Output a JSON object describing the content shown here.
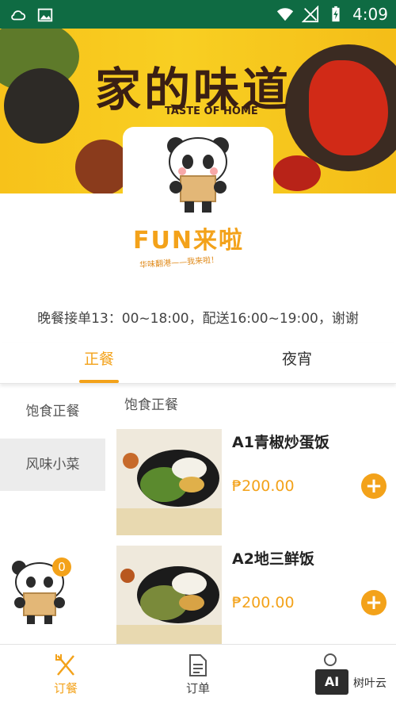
{
  "status_bar": {
    "time": "4:09",
    "icons": [
      "cloud-sync-icon",
      "image-icon",
      "wifi-icon",
      "no-signal-icon",
      "battery-charging-icon"
    ]
  },
  "banner": {
    "title": "家的味道",
    "subtitle": "TASTE OF HOME"
  },
  "brand": {
    "name": "FUN来啦",
    "slogan": "华味翻港——我来啦！"
  },
  "notice": "晚餐接单13：00~18:00，配送16:00~19:00，谢谢",
  "tabs": [
    {
      "label": "正餐",
      "active": true
    },
    {
      "label": "夜宵",
      "active": false
    }
  ],
  "categories": [
    {
      "label": "饱食正餐",
      "selected": false
    },
    {
      "label": "风味小菜",
      "selected": true
    }
  ],
  "section_title": "饱食正餐",
  "products": [
    {
      "name": "A1青椒炒蛋饭",
      "price": "₱200.00"
    },
    {
      "name": "A2地三鲜饭",
      "price": "₱200.00"
    }
  ],
  "cart": {
    "count": "0"
  },
  "bottom_nav": [
    {
      "label": "订餐",
      "icon": "fork-knife-icon",
      "active": true
    },
    {
      "label": "订单",
      "icon": "document-icon",
      "active": false
    },
    {
      "label": "",
      "icon": "user-icon",
      "active": false
    }
  ],
  "watermark": {
    "text": "树叶云",
    "logo_text": "AI"
  },
  "colors": {
    "accent": "#f3a21a",
    "status_bar": "#0f6b43",
    "banner": "#f7c21a"
  }
}
